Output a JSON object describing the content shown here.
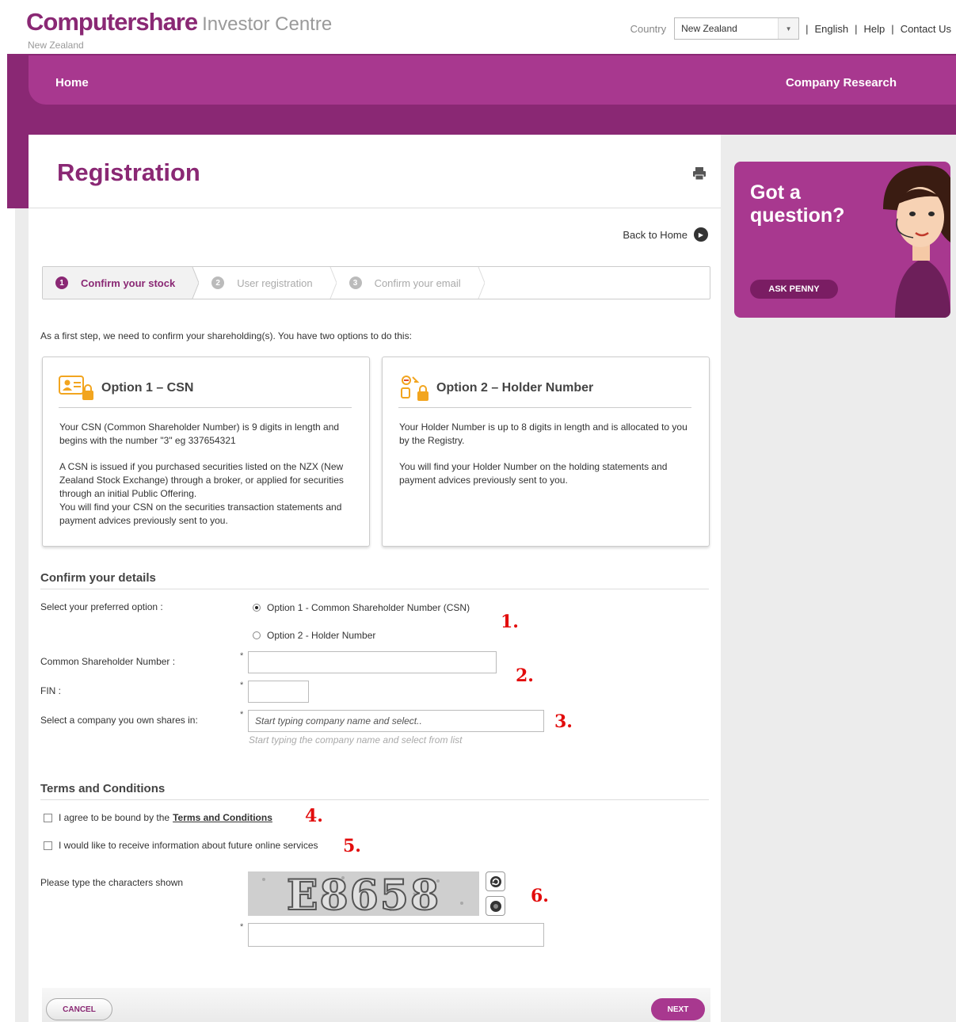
{
  "header": {
    "brand": "Computershare",
    "product": "Investor Centre",
    "region": "New Zealand",
    "country_label": "Country",
    "country_value": "New Zealand",
    "links": [
      "English",
      "Help",
      "Contact Us"
    ]
  },
  "nav": {
    "home": "Home",
    "research": "Company Research"
  },
  "page": {
    "title": "Registration",
    "back_home": "Back to Home"
  },
  "steps": [
    {
      "num": "1",
      "label": "Confirm your stock",
      "active": true
    },
    {
      "num": "2",
      "label": "User registration",
      "active": false
    },
    {
      "num": "3",
      "label": "Confirm your email",
      "active": false
    }
  ],
  "intro": "As a first step, we need to confirm your shareholding(s). You have two options to do this:",
  "option1": {
    "title": "Option 1 – CSN",
    "p1": "Your CSN (Common Shareholder Number) is 9 digits in length and begins with the number \"3\" eg 337654321",
    "p2": "A CSN is issued if you purchased securities listed on the NZX (New Zealand Stock Exchange) through a broker, or applied for securities through an initial Public Offering.",
    "p3": "You will find your CSN on the securities transaction statements and payment advices previously sent to you."
  },
  "option2": {
    "title": "Option 2 – Holder Number",
    "p1": "Your Holder Number is up to 8 digits in length and is allocated to you by the Registry.",
    "p2": "You will find your Holder Number on the holding statements and payment advices previously sent to you."
  },
  "details": {
    "heading": "Confirm your details",
    "select_label": "Select your preferred option :",
    "radio1": "Option 1 - Common Shareholder Number (CSN)",
    "radio2": "Option 2 - Holder Number",
    "csn_label": "Common Shareholder Number :",
    "fin_label": "FIN :",
    "company_label": "Select a company you own shares in:",
    "company_placeholder": "Start typing company name and select..",
    "company_hint": "Start typing the company name and select from list",
    "required": "*"
  },
  "terms": {
    "heading": "Terms and Conditions",
    "agree_prefix": "I agree to be bound by the",
    "agree_link": "Terms and Conditions",
    "info": "I would like to receive information about future online services",
    "captcha_label": "Please type the characters shown",
    "captcha_text": "E8658"
  },
  "markers": [
    "1.",
    "2.",
    "3.",
    "4.",
    "5.",
    "6."
  ],
  "buttons": {
    "cancel": "CANCEL",
    "next": "NEXT"
  },
  "penny": {
    "line1": "Got a",
    "line2": "question?",
    "ask": "ASK PENNY"
  },
  "colors": {
    "brand": "#8a2874",
    "nav": "#a8388f",
    "marker": "#e20c0c"
  }
}
